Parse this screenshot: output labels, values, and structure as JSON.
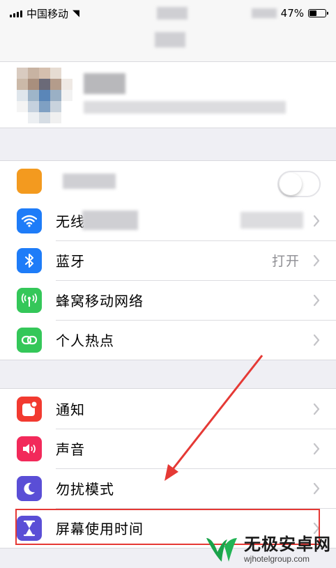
{
  "status_bar": {
    "carrier": "中国移动",
    "battery": "47%",
    "battery_level": 0.47
  },
  "settings": {
    "group1": [
      {
        "id": "wifi",
        "label": "无线",
        "value": "",
        "icon": "wifi-icon",
        "color": "#1e7cf8"
      },
      {
        "id": "bluetooth",
        "label": "蓝牙",
        "value": "打开",
        "icon": "bluetooth-icon",
        "color": "#1e7cf8"
      },
      {
        "id": "cellular",
        "label": "蜂窝移动网络",
        "value": "",
        "icon": "antenna-icon",
        "color": "#34c759"
      },
      {
        "id": "hotspot",
        "label": "个人热点",
        "value": "",
        "icon": "hotspot-icon",
        "color": "#34c759"
      }
    ],
    "group2": [
      {
        "id": "notifications",
        "label": "通知",
        "value": "",
        "icon": "notification-icon",
        "color": "#f23a30"
      },
      {
        "id": "sounds",
        "label": "声音",
        "value": "",
        "icon": "speaker-icon",
        "color": "#f2295a"
      },
      {
        "id": "dnd",
        "label": "勿扰模式",
        "value": "",
        "icon": "moon-icon",
        "color": "#5a4ed6"
      },
      {
        "id": "screen_time",
        "label": "屏幕使用时间",
        "value": "",
        "icon": "hourglass-icon",
        "color": "#5a4ed6"
      }
    ]
  },
  "airplane_toggle": {
    "on": false
  },
  "watermark": {
    "brand": "无极安卓网",
    "url": "wjhotelgroup.com"
  }
}
